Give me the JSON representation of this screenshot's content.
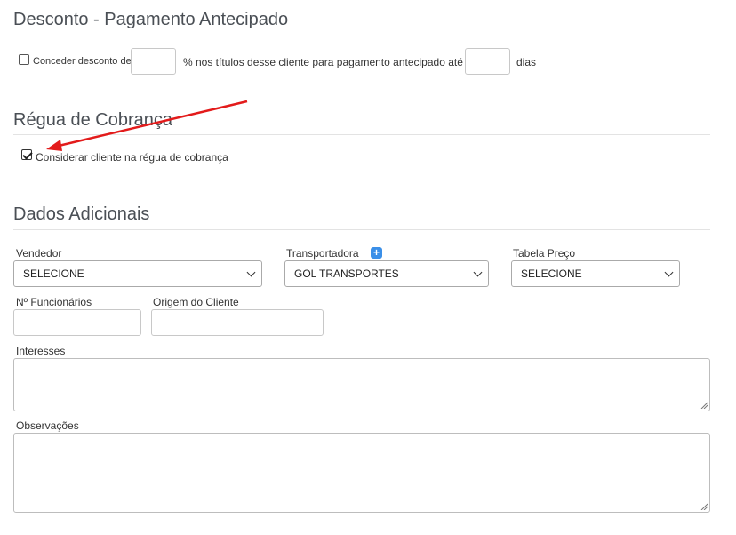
{
  "desconto": {
    "title": "Desconto - Pagamento Antecipado",
    "checkbox_label": "Conceder desconto de",
    "middle_text": "% nos títulos desse cliente para pagamento antecipado até",
    "days_label": "dias",
    "checked": false
  },
  "regua": {
    "title": "Régua de Cobrança",
    "checkbox_label": "Considerar cliente na régua de cobrança",
    "checked": true
  },
  "dados": {
    "title": "Dados Adicionais",
    "vendedor": {
      "label": "Vendedor",
      "value": "SELECIONE"
    },
    "transportadora": {
      "label": "Transportadora",
      "value": "GOL TRANSPORTES",
      "add_icon": "plus-icon"
    },
    "tabela_preco": {
      "label": "Tabela Preço",
      "value": "SELECIONE"
    },
    "funcionarios": {
      "label": "Nº Funcionários",
      "value": ""
    },
    "origem": {
      "label": "Origem do Cliente",
      "value": ""
    },
    "interesses": {
      "label": "Interesses",
      "value": ""
    },
    "observacoes": {
      "label": "Observações",
      "value": ""
    }
  },
  "annotation": {
    "color": "#e31b1b",
    "icon": "red-arrow-icon"
  }
}
